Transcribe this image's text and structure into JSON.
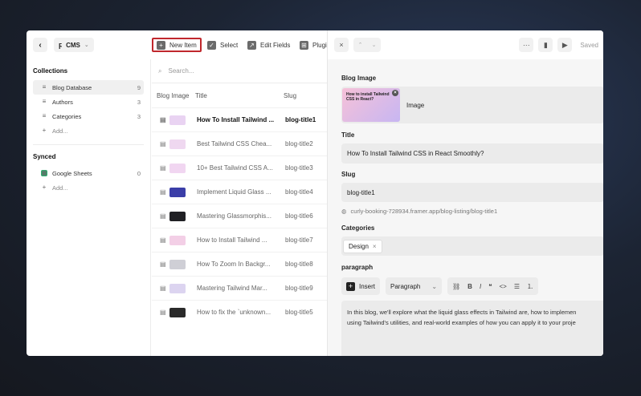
{
  "topbar": {
    "back_icon": "chevron-left-icon",
    "app_label": "CMS",
    "new_item": "New Item",
    "select": "Select",
    "edit_fields": "Edit Fields",
    "plugins": "Plugi"
  },
  "sidebar": {
    "collections_title": "Collections",
    "collections": [
      {
        "label": "Blog Database",
        "count": "9",
        "active": true
      },
      {
        "label": "Authors",
        "count": "3"
      },
      {
        "label": "Categories",
        "count": "3"
      }
    ],
    "add_label": "Add...",
    "synced_title": "Synced",
    "synced": [
      {
        "label": "Google Sheets",
        "count": "0"
      }
    ],
    "synced_add": "Add..."
  },
  "table": {
    "search_placeholder": "Search...",
    "headers": {
      "image": "Blog Image",
      "title": "Title",
      "slug": "Slug"
    },
    "rows": [
      {
        "title": "How To Install Tailwind ...",
        "slug": "blog-title1",
        "thumb": "#e9d3f2"
      },
      {
        "title": "Best Tailwind CSS Chea...",
        "slug": "blog-title2",
        "thumb": "#efd8f0"
      },
      {
        "title": "10+ Best Tailwind CSS A...",
        "slug": "blog-title3",
        "thumb": "#f1d6f1"
      },
      {
        "title": "Implement Liquid Glass ...",
        "slug": "blog-title4",
        "thumb": "#3b3ea8"
      },
      {
        "title": "Mastering Glassmorphis...",
        "slug": "blog-title6",
        "thumb": "#202024"
      },
      {
        "title": "How to Install Tailwind ...",
        "slug": "blog-title7",
        "thumb": "#f3cfe6"
      },
      {
        "title": "How To Zoom In Backgr...",
        "slug": "blog-title8",
        "thumb": "#cfcfd6"
      },
      {
        "title": "Mastering Tailwind Mar...",
        "slug": "blog-title9",
        "thumb": "#dcd4f0"
      },
      {
        "title": "How to fix the `unknown...",
        "slug": "blog-title5",
        "thumb": "#2a2a2a"
      }
    ]
  },
  "panel": {
    "saved": "Saved",
    "blog_image_label": "Blog Image",
    "image_caption": "Image",
    "thumb_text": "How to install Tailwind CSS in React?",
    "title_label": "Title",
    "title_value": "How To Install Tailwind CSS in React Smoothly?",
    "slug_label": "Slug",
    "slug_value": "blog-title1",
    "url": "curly-booking-728934.framer.app/blog-listing/blog-title1",
    "categories_label": "Categories",
    "category_chip": "Design",
    "paragraph_label": "paragraph",
    "insert": "Insert",
    "style_select": "Paragraph",
    "content_line1": "In this blog, we'll explore what the liquid glass effects in Tailwind are, how to implemen",
    "content_line2": "using Tailwind's utilities, and real-world examples of how you can apply it to your proje"
  }
}
